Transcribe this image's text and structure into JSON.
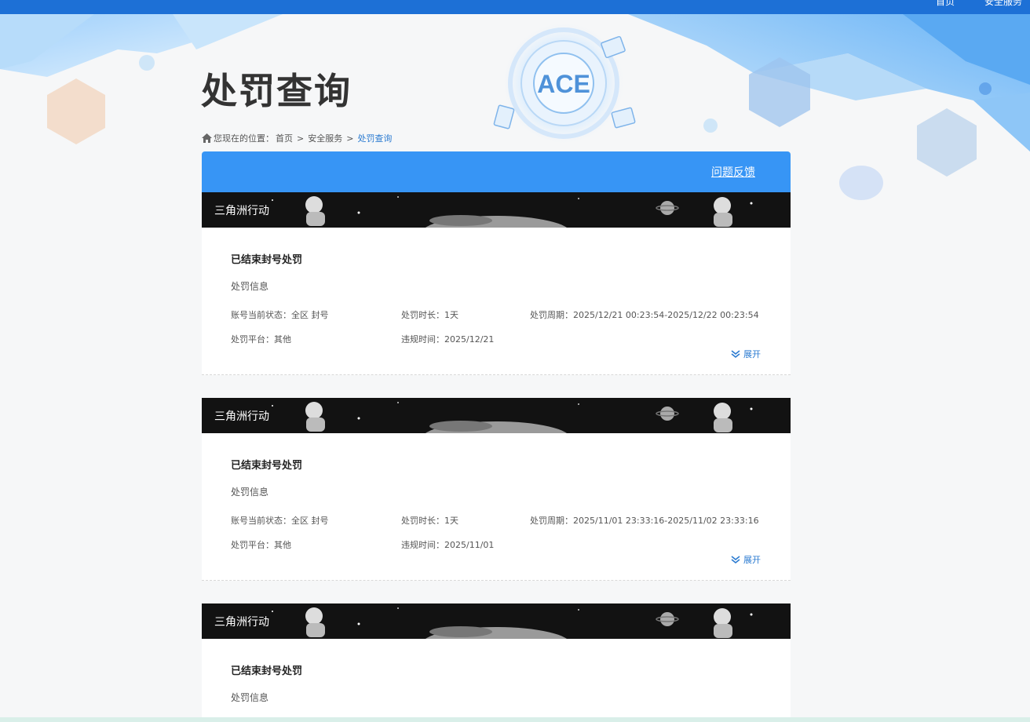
{
  "topnav": {
    "home": "首页",
    "security": "安全服务"
  },
  "header": {
    "title": "处罚查询",
    "logo_text": "ACE"
  },
  "breadcrumb": {
    "prefix": "您现在的位置：",
    "home": "首页",
    "security": "安全服务",
    "current": "处罚查询",
    "separator": ">"
  },
  "panel": {
    "feedback": "问题反馈"
  },
  "records": [
    {
      "game": "三角洲行动",
      "title": "已结束封号处罚",
      "subtitle": "处罚信息",
      "status_label": "账号当前状态：",
      "status_value": "全区 封号",
      "duration_label": "处罚时长：",
      "duration_value": "1天",
      "period_label": "处罚周期：",
      "period_value": "2025/12/21 00:23:54-2025/12/22 00:23:54",
      "platform_label": "处罚平台：",
      "platform_value": "其他",
      "violation_label": "违规时间：",
      "violation_value": "2025/12/21",
      "expand": "展开"
    },
    {
      "game": "三角洲行动",
      "title": "已结束封号处罚",
      "subtitle": "处罚信息",
      "status_label": "账号当前状态：",
      "status_value": "全区 封号",
      "duration_label": "处罚时长：",
      "duration_value": "1天",
      "period_label": "处罚周期：",
      "period_value": "2025/11/01 23:33:16-2025/11/02 23:33:16",
      "platform_label": "处罚平台：",
      "platform_value": "其他",
      "violation_label": "违规时间：",
      "violation_value": "2025/11/01",
      "expand": "展开"
    },
    {
      "game": "三角洲行动",
      "title": "已结束封号处罚",
      "subtitle": "处罚信息"
    }
  ],
  "colors": {
    "topbar": "#1d70d6",
    "panel_head": "#3795f5",
    "link": "#2b7bd1"
  }
}
